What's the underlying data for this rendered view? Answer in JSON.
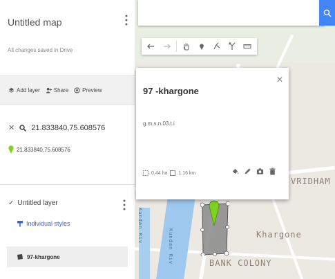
{
  "panel": {
    "title": "Untitled map",
    "save_status": "All changes saved in Drive",
    "actions": [
      {
        "icon": "add-layer-icon",
        "label": "Add layer"
      },
      {
        "icon": "share-icon",
        "label": "Share"
      },
      {
        "icon": "preview-icon",
        "label": "Preview"
      }
    ],
    "search_query": "21.833840,75.608576",
    "search_result": "21.833840,75.608576",
    "layer": {
      "name": "Untitled layer",
      "checked": true,
      "styles_label": "Individual styles",
      "feature": "97-khargone"
    }
  },
  "card": {
    "title": "97 -khargone",
    "description": "g.m.s.n.03.t.i",
    "area": "0.44 ha",
    "perimeter": "1.16 km"
  },
  "map": {
    "labels": {
      "vridham": "VRIDHAM",
      "khargone": "Khargone",
      "bank_colony": "BANK COLONY",
      "river": "Kundan Riv",
      "river2": "Kundan Riv"
    }
  },
  "colors": {
    "accent": "#4285f4",
    "marker": "#7ed321",
    "link": "#3367d6"
  }
}
